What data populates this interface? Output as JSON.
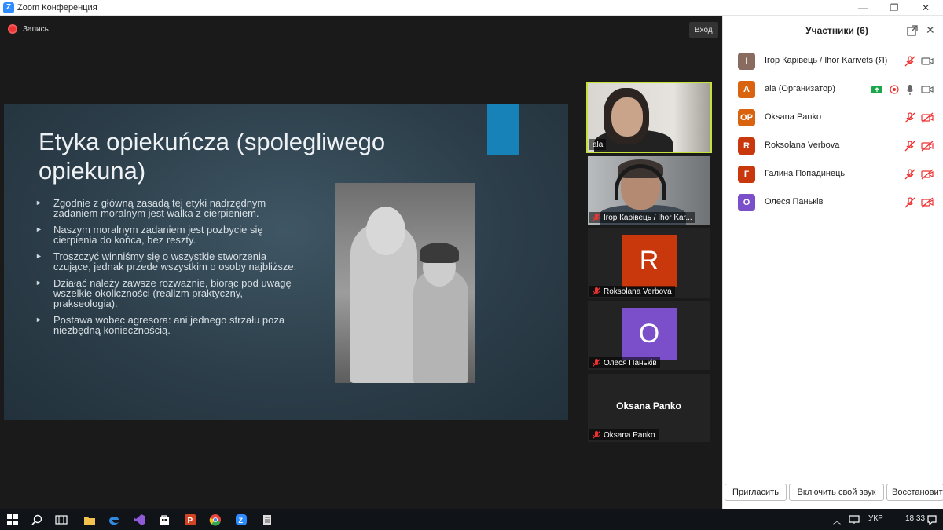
{
  "window": {
    "title": "Zoom Конференция",
    "controls": {
      "minimize": "—",
      "maximize": "❐",
      "close": "✕"
    }
  },
  "meeting": {
    "recording_label": "Запись",
    "exit_label": "Вход"
  },
  "slide": {
    "title": "Etyka opiekuńcza (spolegliwego opiekuna)",
    "bullets": [
      "Zgodnie z główną zasadą tej etyki nadrzędnym zadaniem moralnym jest walka z cierpieniem.",
      "Naszym moralnym zadaniem jest pozbycie się cierpienia do końca, bez reszty.",
      "Troszczyć winniśmy się o wszystkie stworzenia czujące, jednak przede wszystkim o osoby najbliższe.",
      "Działać należy zawsze rozważnie, biorąc pod uwagę wszelkie okoliczności (realizm praktyczny, prakseologia).",
      "Postawa wobec agresora: ani jednego strzału poza niezbędną koniecznością."
    ],
    "bullet_glyph": "►",
    "accent_color": "#1682b8"
  },
  "videos": [
    {
      "name": "ala",
      "muted": false
    },
    {
      "name": "Ігор Карівець / Ihor Kar...",
      "muted": true
    },
    {
      "name": "Roksolana Verbova",
      "muted": true,
      "initial": "R",
      "color": "#c9380d"
    },
    {
      "name": "Олеся Паньків",
      "muted": true,
      "initial": "O",
      "color": "#7a4fc9"
    },
    {
      "name": "Oksana Panko",
      "muted": true,
      "display_name": "Oksana Panko"
    }
  ],
  "panel": {
    "title": "Участники (6)",
    "participants": [
      {
        "initial": "I",
        "name": "Ігор Карівець / Ihor Karivets (Я)",
        "color": "#8a6b60"
      },
      {
        "initial": "A",
        "name": "ala (Организатор)",
        "color": "#d9630e"
      },
      {
        "initial": "OP",
        "name": "Oksana Panko",
        "color": "#d9630e"
      },
      {
        "initial": "R",
        "name": "Roksolana Verbova",
        "color": "#c9380d"
      },
      {
        "initial": "Г",
        "name": "Галина Попадинець",
        "color": "#c9380d"
      },
      {
        "initial": "O",
        "name": "Олеся Паньків",
        "color": "#7a4fc9"
      }
    ],
    "buttons": {
      "invite": "Пригласить",
      "unmute": "Включить свой звук",
      "restore": "Восстановит"
    }
  },
  "taskbar": {
    "language": "УКР",
    "time": "18:33"
  }
}
